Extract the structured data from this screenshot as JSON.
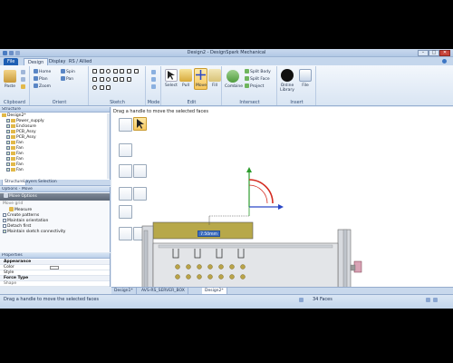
{
  "window": {
    "title": "Design2 - DesignSpark Mechanical",
    "minimize": "–",
    "maximize": "□",
    "close": "✕"
  },
  "tabs": [
    {
      "label": "File"
    },
    {
      "label": "Design"
    },
    {
      "label": "Display"
    },
    {
      "label": "RS / Allied"
    }
  ],
  "ribbon": {
    "clipboard": {
      "label": "Clipboard",
      "paste": "Paste"
    },
    "orient": {
      "label": "Orient",
      "home": "Home",
      "plan": "Plan",
      "zoom": "Zoom",
      "spin": "Spin",
      "pan": "Pan"
    },
    "sketch": {
      "label": "Sketch"
    },
    "mode": {
      "label": "Mode"
    },
    "edit": {
      "label": "Edit",
      "select": "Select",
      "pull": "Pull",
      "move": "Move",
      "fill": "Fill"
    },
    "intersect": {
      "label": "Intersect",
      "combine": "Combine",
      "split_body": "Split Body",
      "split_face": "Split Face",
      "project": "Project"
    },
    "insert": {
      "label": "Insert",
      "online_library": "Online Library",
      "file": "File"
    }
  },
  "structure": {
    "header": "Structure",
    "items": [
      {
        "label": "Design2*"
      },
      {
        "label": "Power_supply"
      },
      {
        "label": "Enclosure"
      },
      {
        "label": "PCB_Assy"
      },
      {
        "label": "PCB_Assy"
      },
      {
        "label": "Fan"
      },
      {
        "label": "Fan"
      },
      {
        "label": "Fan"
      },
      {
        "label": "Fan"
      },
      {
        "label": "Fan"
      },
      {
        "label": "Fan"
      }
    ],
    "tabs": [
      {
        "label": "Structure"
      },
      {
        "label": "Layers"
      },
      {
        "label": "Selection"
      }
    ]
  },
  "options": {
    "header": "Options - Move",
    "move_options": "Move Options",
    "move_grid": "Move grid",
    "measure": "Measure",
    "items": [
      {
        "label": "Create patterns",
        "checked": false
      },
      {
        "label": "Maintain orientation",
        "checked": false
      },
      {
        "label": "Detach first",
        "checked": false
      },
      {
        "label": "Maintain sketch connectivity",
        "checked": true
      }
    ]
  },
  "properties": {
    "header": "Properties",
    "appearance": "Appearance",
    "rows": [
      {
        "label": "Color"
      },
      {
        "label": "Style"
      }
    ],
    "force_type": "Force Type",
    "shape": "Shape"
  },
  "viewport": {
    "hint": "Drag a handle to move the selected faces",
    "dimension": "7.50mm"
  },
  "doc_tabs": [
    {
      "label": "Design1*"
    },
    {
      "label": "AVS-RS_SERVER_BOX"
    },
    {
      "label": "Design2*"
    }
  ],
  "status": {
    "message": "Drag a handle to move the selected faces",
    "faces": "34 Faces"
  },
  "colors": {
    "accent": "#1e5fb4",
    "ribbon_bg": "#dfe8f3",
    "handle_red": "#d42a1f",
    "handle_green": "#2b9b2b",
    "handle_blue": "#2a47c6"
  }
}
